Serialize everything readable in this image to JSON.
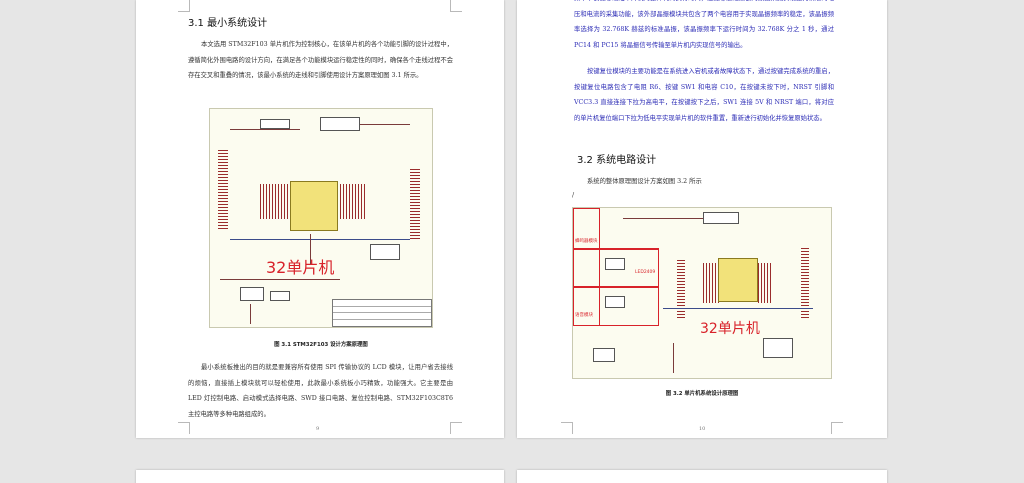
{
  "pages": {
    "left": {
      "heading": "3.1  最小系统设计",
      "para1": "本文选用 STM32F103 单片机作为控制核心，在该单片机的各个功能引脚的设计过程中，遵循简化外围电路的设计方向，在满足各个功能模块运行稳定性的同时，确保各个走线过程不会存在交叉和重叠的情况，该最小系统的走线和引脚使用设计方案原理如图 3.1 所示。",
      "figure_label": "32单片机",
      "caption": "图 3.1 STM32F103 设计方案原理图",
      "para2": "最小系统板推出的目的就是要兼容所有使用 SPI 传输协议的 LCD 模块，让用户省去接线的烦恼，直接插上模块就可以轻松使用，此款最小系统板小巧精致，功能强大。它主要是由 LED 灯控制电路、启动模式选择电路、SWD 接口电路、复位控制电路、STM32F103C8T6 主控电路等多种电路组成的。",
      "page_number": "9"
    },
    "right": {
      "para_top": "频率不仅能够缩短单片机的整体代码执行时间，还能够通过高额的数据采集实现更为精准的电压和电流的采集功能，该外部晶振模块共包含了两个电容用于实现晶振频率的稳定，该晶振频率选择为 32.768K 赫兹的标准晶振，该晶振频率下运行时间为 32.768K 分之 1 秒，通过 PC14 和 PC15 将晶振信号传输至单片机内实现信号的输出。",
      "para_reset": "按键复位模块的主要功能是在系统进入宕机或者故障状态下，通过按键完成系统的重启，按键复位电路包含了电阻 R6、按键 SW1 和电容 C10，在按键未按下时，NRST 引脚和 VCC3.3 直接连接下拉为高电平，在按键按下之后，SW1 连接 5V 和 NRST 端口，将对应的单片机复位端口下拉为低电平实现单片机的软件重置，重新进行初始化并恢复原始状态。",
      "heading": "3.2  系统电路设计",
      "para_intro": "系统的整体原理图设计方案如图 3.2 所示",
      "slash": "/",
      "figure_label": "32单片机",
      "tags": [
        "蜂鸣器模块",
        "LED2409",
        "语音模块"
      ],
      "caption": "图 3.2  单片机系统设计原理图",
      "page_number": "10"
    }
  },
  "colors": {
    "accent_red": "#d8222a",
    "body_text": "#333333",
    "blue_text": "#2b2bb5"
  }
}
